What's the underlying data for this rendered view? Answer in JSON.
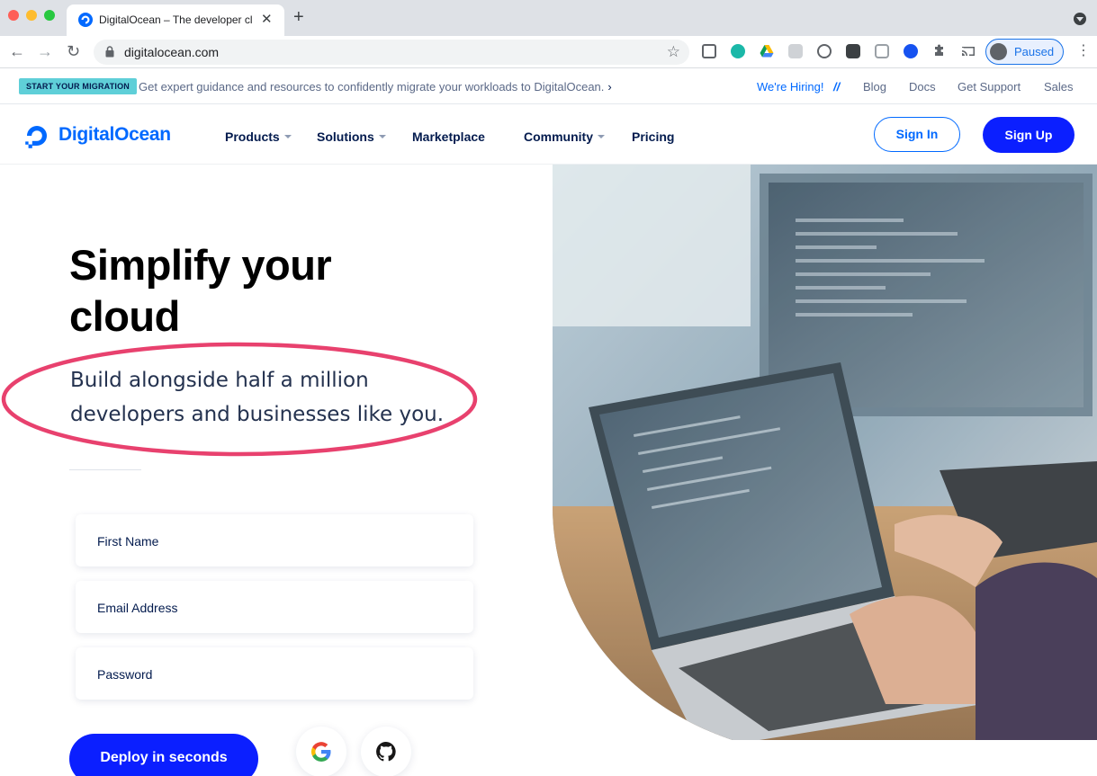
{
  "browser": {
    "tab_title": "DigitalOcean – The developer cloud",
    "tab_close": "✕",
    "new_tab": "+",
    "url": "digitalocean.com",
    "profile_label": "Paused",
    "kebab": "⋮",
    "star": "☆",
    "back": "←",
    "forward": "→",
    "reload": "↻"
  },
  "announcement": {
    "badge": "START YOUR MIGRATION",
    "text": "Get expert guidance and resources to confidently migrate your workloads to DigitalOcean.",
    "chevron": "›",
    "hiring": "We're Hiring!",
    "separator": "//",
    "links": [
      "Blog",
      "Docs",
      "Get Support",
      "Sales"
    ]
  },
  "nav": {
    "logo_text": "DigitalOcean",
    "items": [
      "Products",
      "Solutions",
      "Marketplace",
      "Community",
      "Pricing"
    ],
    "signin": "Sign In",
    "signup": "Sign Up"
  },
  "hero": {
    "title": "Simplify your cloud",
    "subtitle": "Build alongside half a million developers and businesses like you.",
    "fields": [
      "First Name",
      "Email Address",
      "Password"
    ],
    "cta": "Deploy in seconds"
  },
  "colors": {
    "brand_blue": "#0069ff",
    "cta_blue": "#0b1fff",
    "annotation": "#e8416e",
    "badge": "#5fcfd8"
  }
}
